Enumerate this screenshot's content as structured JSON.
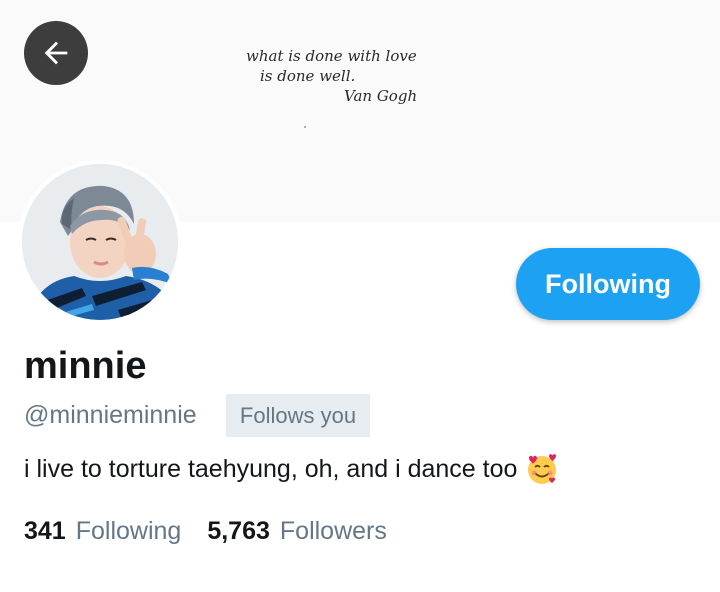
{
  "banner": {
    "quote_line1": "what is done with love",
    "quote_line2": "is done well.",
    "quote_author": "Van Gogh"
  },
  "profile": {
    "display_name": "minnie",
    "handle": "@minnieminnie",
    "follows_you_label": "Follows you",
    "bio": "i live to torture taehyung, oh, and i dance too",
    "bio_emoji": "smiling-face-with-hearts-icon"
  },
  "actions": {
    "follow_button_label": "Following"
  },
  "stats": {
    "following_count": "341",
    "following_label": "Following",
    "followers_count": "5,763",
    "followers_label": "Followers"
  },
  "colors": {
    "accent": "#1da1f2",
    "secondary_text": "#657786",
    "badge_bg": "#e6ecf0",
    "back_button_bg": "#3d3d3d"
  }
}
